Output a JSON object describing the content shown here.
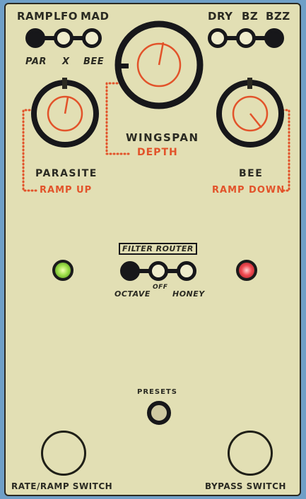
{
  "top_left_switch": {
    "labels_top": [
      "RAMP",
      "LFO",
      "MAD"
    ],
    "labels_bottom": [
      "PAR",
      "X",
      "BEE"
    ]
  },
  "top_right_switch": {
    "labels_top": [
      "DRY",
      "BZ",
      "BZZ"
    ]
  },
  "knobs": {
    "wingspan": {
      "label": "WINGSPAN",
      "ramp_label": "DEPTH"
    },
    "parasite": {
      "label": "PARASITE",
      "ramp_label": "RAMP UP"
    },
    "bee": {
      "label": "BEE",
      "ramp_label": "RAMP DOWN"
    }
  },
  "filter_router": {
    "title": "FILTER ROUTER",
    "labels": [
      "OCTAVE",
      "OFF",
      "HONEY"
    ]
  },
  "leds": {
    "left_color": "#9ee04a",
    "right_color": "#f24a52"
  },
  "presets": {
    "label": "PRESETS"
  },
  "footswitches": {
    "left": "RATE/RAMP SWITCH",
    "right": "BYPASS SWITCH"
  },
  "colors": {
    "enclosure": "#e2dfb4",
    "ink": "#17171a",
    "accent_orange": "#e2532a",
    "background": "#6f9fc7"
  }
}
